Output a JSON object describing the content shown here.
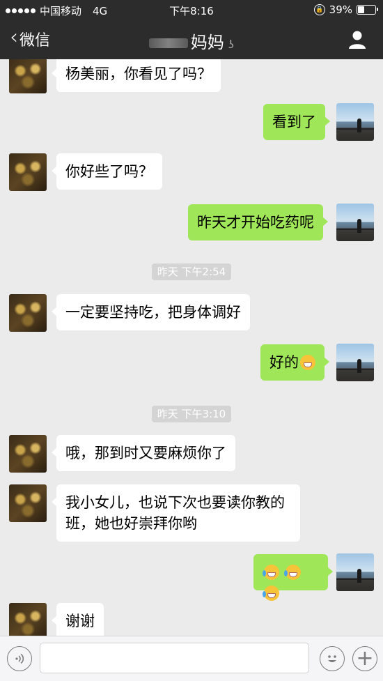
{
  "status_bar": {
    "carrier": "中国移动",
    "network": "4G",
    "time": "下午8:16",
    "battery": "39%",
    "battery_level": 0.39
  },
  "nav": {
    "back_label": "微信",
    "contact_name": "妈妈"
  },
  "messages": [
    {
      "side": "in",
      "text": "杨美丽，你看见了吗？"
    },
    {
      "side": "out",
      "text": "看到了"
    },
    {
      "side": "in",
      "text": "你好些了吗？"
    },
    {
      "side": "out",
      "text": "昨天才开始吃药呢"
    },
    {
      "timestamp": "昨天 下午2:54"
    },
    {
      "side": "in",
      "text": "一定要坚持吃，把身体调好"
    },
    {
      "side": "out",
      "text": "好的",
      "emoji": "grin-emoji"
    },
    {
      "timestamp": "昨天 下午3:10"
    },
    {
      "side": "in",
      "text": "哦，那到时又要麻烦你了"
    },
    {
      "side": "in",
      "line1": "我小女儿，也说下次也要读你教的",
      "line2": "班，她也好崇拜你哟"
    },
    {
      "side": "out",
      "emoji": "crying-laughing-emoji x3"
    },
    {
      "side": "in",
      "text": "谢谢"
    }
  ],
  "colors": {
    "header_bg": "#2c2c2c",
    "chat_bg": "#ebebeb",
    "outgoing_bubble": "#9fe658",
    "incoming_bubble": "#ffffff"
  }
}
